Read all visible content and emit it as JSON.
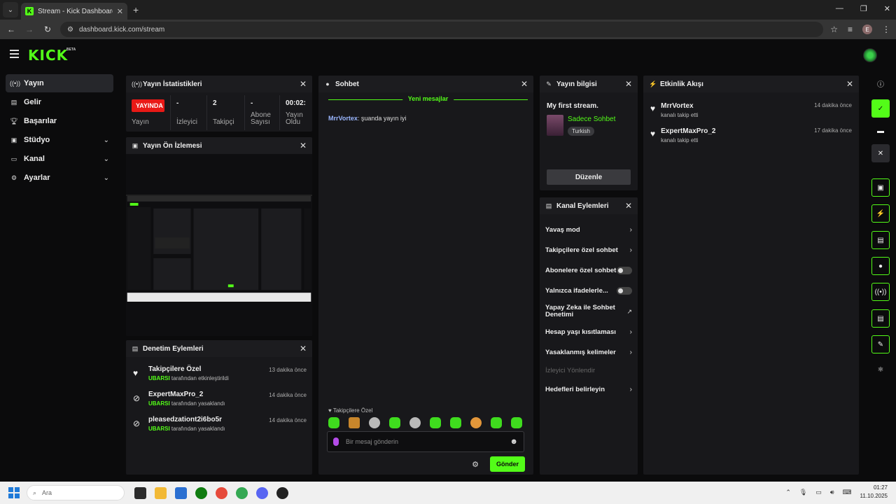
{
  "browser": {
    "tab_title": "Stream - Kick Dashboard",
    "url": "dashboard.kick.com/stream",
    "profile_initial": "E"
  },
  "brand": {
    "logo": "KICK",
    "beta": "BETA",
    "accent": "#53fc18"
  },
  "sidebar": {
    "items": [
      {
        "label": "Yayın",
        "icon": "live-icon",
        "active": true
      },
      {
        "label": "Gelir",
        "icon": "revenue-icon"
      },
      {
        "label": "Başarılar",
        "icon": "trophy-icon"
      },
      {
        "label": "Stüdyo",
        "icon": "studio-icon",
        "expandable": true
      },
      {
        "label": "Kanal",
        "icon": "channel-icon",
        "expandable": true
      },
      {
        "label": "Ayarlar",
        "icon": "gear-icon",
        "expandable": true
      }
    ]
  },
  "stats": {
    "title": "Yayın İstatistikleri",
    "live_badge": "YAYINDA",
    "items": [
      {
        "value": "",
        "label": "Yayın"
      },
      {
        "value": "-",
        "label": "İzleyici"
      },
      {
        "value": "2",
        "label": "Takipçi"
      },
      {
        "value": "-",
        "label": "Abone Sayısı"
      },
      {
        "value": "00:02:",
        "label": "Yayın Oldu"
      }
    ]
  },
  "preview": {
    "title": "Yayın Ön İzlemesi"
  },
  "moderation": {
    "title": "Denetim Eylemleri",
    "items": [
      {
        "name": "Takipçilere Özel",
        "by": "UBARSI",
        "action": "tarafından etkinleştirildi",
        "time": "13 dakika önce",
        "icon": "heart-icon"
      },
      {
        "name": "ExpertMaxPro_2",
        "by": "UBARSI",
        "action": "tarafından yasaklandı",
        "time": "14 dakika önce",
        "icon": "ban-icon"
      },
      {
        "name": "pleasedzationt2i6bo5r",
        "by": "UBARSI",
        "action": "tarafından yasaklandı",
        "time": "14 dakika önce",
        "icon": "ban-icon"
      }
    ]
  },
  "chat": {
    "title": "Sohbet",
    "new_messages": "Yeni mesajlar",
    "messages": [
      {
        "user": "MrrVortex",
        "text": ": şuanda yayın iyi"
      }
    ],
    "mode": "Takipçilere Özel",
    "placeholder": "Bir mesaj gönderin",
    "send": "Gönder"
  },
  "stream_info": {
    "title": "Yayın bilgisi",
    "stream_title": "My first stream.",
    "category": "Sadece Sohbet",
    "tag": "Turkish",
    "edit": "Düzenle"
  },
  "channel_actions": {
    "title": "Kanal Eylemleri",
    "items": [
      {
        "label": "Yavaş mod",
        "control": "chevron"
      },
      {
        "label": "Takipçilere özel sohbet",
        "control": "chevron"
      },
      {
        "label": "Abonelere özel sohbet",
        "control": "toggle"
      },
      {
        "label": "Yalnızca ifadelerle...",
        "control": "toggle"
      },
      {
        "label": "Yapay Zeka ile Sohbet Denetimi",
        "control": "external"
      },
      {
        "label": "Hesap yaşı kısıtlaması",
        "control": "chevron"
      },
      {
        "label": "Yasaklanmış kelimeler",
        "control": "chevron"
      },
      {
        "label": "İzleyici Yönlendir",
        "control": "none",
        "disabled": true
      },
      {
        "label": "Hedefleri belirleyin",
        "control": "chevron"
      }
    ]
  },
  "activity": {
    "title": "Etkinlik Akışı",
    "items": [
      {
        "name": "MrrVortex",
        "sub": "kanalı takip etti",
        "time": "14 dakika önce"
      },
      {
        "name": "ExpertMaxPro_2",
        "sub": "kanalı takip etti",
        "time": "17 dakika önce"
      }
    ]
  },
  "taskbar": {
    "search_placeholder": "Ara",
    "time": "01:27",
    "date": "11.10.2025"
  }
}
